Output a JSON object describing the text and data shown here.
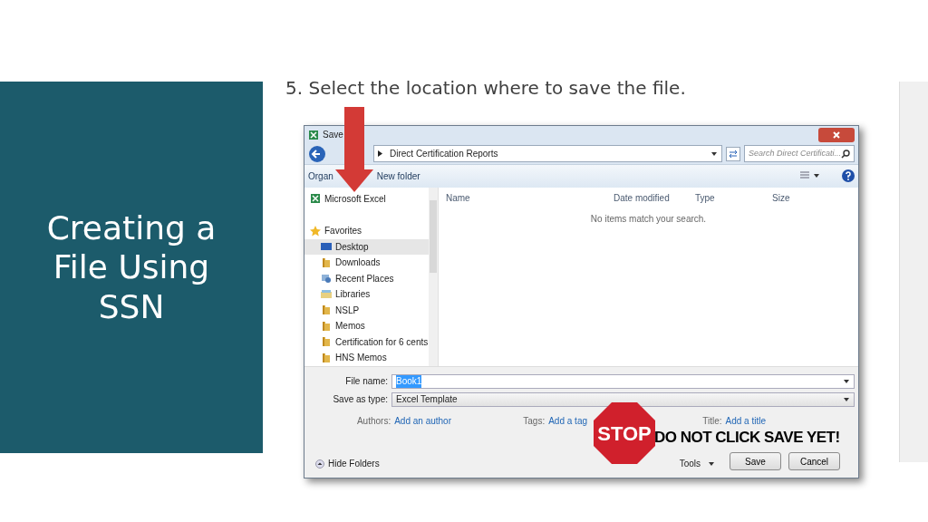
{
  "slide": {
    "title": "Creating a File Using SSN",
    "instruction": "5. Select the location where to save the file."
  },
  "dialog": {
    "title": "Save",
    "path": "Direct Certification Reports",
    "search": {
      "placeholder": "Search Direct Certificati..."
    },
    "toolbar": [
      "Organ",
      "New folder"
    ],
    "nav_items": [
      {
        "label": "Microsoft Excel",
        "kind": "app",
        "selected": false
      },
      {
        "label": "Favorites",
        "kind": "star",
        "selected": false
      },
      {
        "label": "Desktop",
        "kind": "desktop",
        "selected": true
      },
      {
        "label": "Downloads",
        "kind": "folder",
        "selected": false
      },
      {
        "label": "Recent Places",
        "kind": "recent",
        "selected": false
      },
      {
        "label": "Libraries",
        "kind": "library",
        "selected": false
      },
      {
        "label": "NSLP",
        "kind": "folder",
        "selected": false
      },
      {
        "label": "Memos",
        "kind": "folder",
        "selected": false
      },
      {
        "label": "Certification for 6 cents",
        "kind": "folder",
        "selected": false
      },
      {
        "label": "HNS Memos",
        "kind": "folder",
        "selected": false
      }
    ],
    "columns": [
      "Name",
      "Date modified",
      "Type",
      "Size"
    ],
    "empty_message": "No items match your search.",
    "file_name": {
      "label": "File name:",
      "value": "Book1"
    },
    "save_type": {
      "label": "Save as type:",
      "value": "Excel Template"
    },
    "meta": [
      {
        "label": "Authors:",
        "link": "Add an author"
      },
      {
        "label": "Tags:",
        "link": "Add a tag"
      },
      {
        "label": "Title:",
        "link": "Add a title"
      }
    ],
    "hide_folders": "Hide Folders",
    "tools": "Tools",
    "buttons": [
      "Save",
      "Cancel"
    ]
  },
  "stop_sign": {
    "sign": "STOP",
    "warning": "DO NOT CLICK SAVE YET!"
  }
}
